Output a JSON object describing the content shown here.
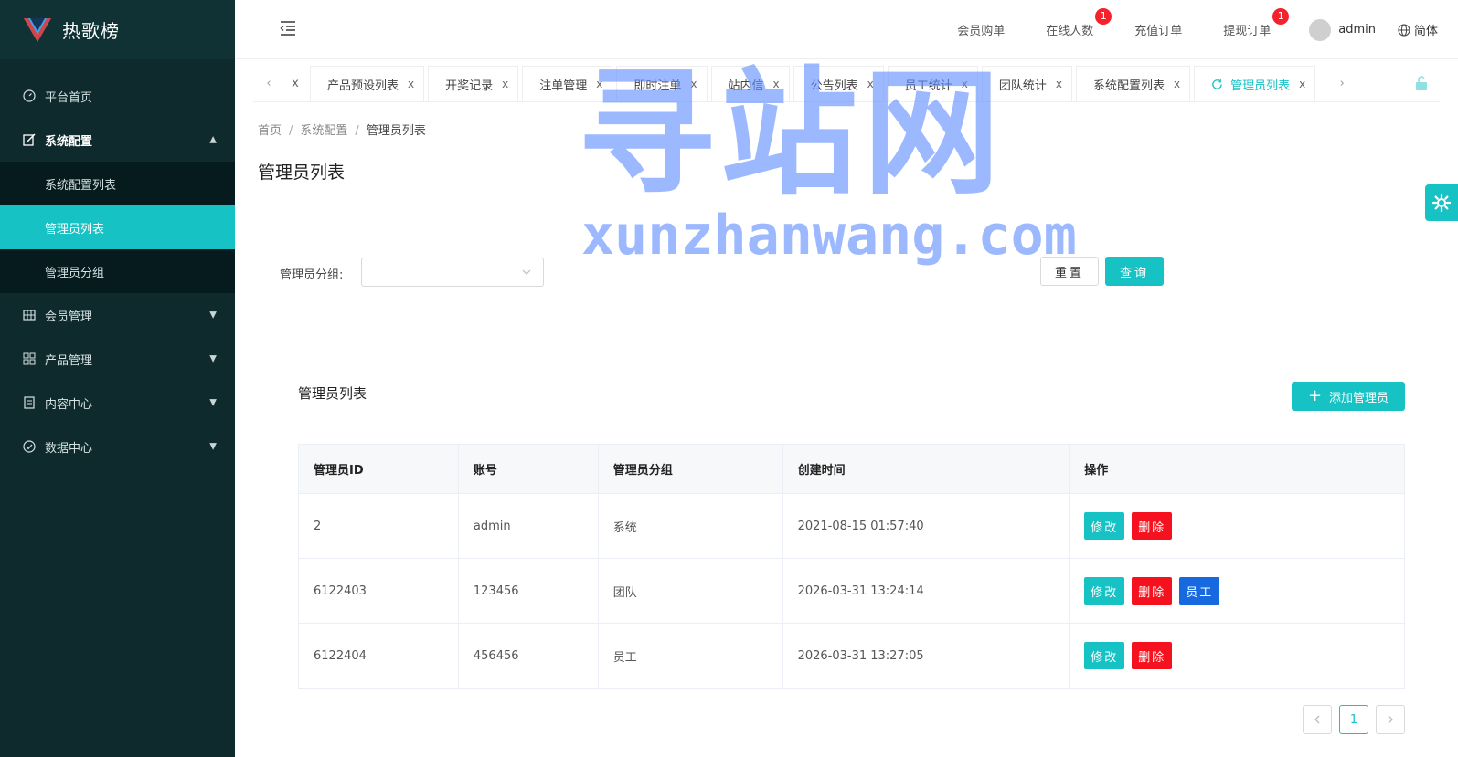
{
  "app": {
    "title": "热歌榜"
  },
  "sidebar": {
    "items": [
      {
        "label": "平台首页",
        "icon": "dashboard-icon"
      },
      {
        "label": "系统配置",
        "icon": "edit-icon",
        "open": true,
        "children": [
          {
            "label": "系统配置列表"
          },
          {
            "label": "管理员列表",
            "active": true
          },
          {
            "label": "管理员分组"
          }
        ]
      },
      {
        "label": "会员管理",
        "icon": "grid-icon"
      },
      {
        "label": "产品管理",
        "icon": "apps-icon"
      },
      {
        "label": "内容中心",
        "icon": "document-icon"
      },
      {
        "label": "数据中心",
        "icon": "check-circle-icon"
      }
    ]
  },
  "header": {
    "links": [
      {
        "label": "会员购单"
      },
      {
        "label": "在线人数",
        "badge": "1"
      },
      {
        "label": "充值订单"
      },
      {
        "label": "提现订单",
        "badge": "1"
      }
    ],
    "user": "admin",
    "lang": "简体"
  },
  "tabs": [
    {
      "label": "产品预设列表"
    },
    {
      "label": "开奖记录"
    },
    {
      "label": "注单管理"
    },
    {
      "label": "即时注单"
    },
    {
      "label": "站内信"
    },
    {
      "label": "公告列表"
    },
    {
      "label": "员工统计"
    },
    {
      "label": "团队统计"
    },
    {
      "label": "系统配置列表"
    },
    {
      "label": "管理员列表",
      "active": true
    }
  ],
  "tab_close": "x",
  "breadcrumb": [
    "首页",
    "系统配置",
    "管理员列表"
  ],
  "breadcrumb_sep": "/",
  "page_title": "管理员列表",
  "filter": {
    "label": "管理员分组:",
    "value": "",
    "reset": "重置",
    "query": "查询"
  },
  "list": {
    "title": "管理员列表",
    "add_button": "添加管理员",
    "columns": [
      "管理员ID",
      "账号",
      "管理员分组",
      "创建时间",
      "操作"
    ],
    "rows": [
      {
        "id": "2",
        "account": "admin",
        "group": "系统",
        "created": "2021-08-15 01:57:40",
        "actions": [
          "修改",
          "删除"
        ]
      },
      {
        "id": "6122403",
        "account": "123456",
        "group": "团队",
        "created": "2026-03-31 13:24:14",
        "actions": [
          "修改",
          "删除",
          "员工"
        ]
      },
      {
        "id": "6122404",
        "account": "456456",
        "group": "员工",
        "created": "2026-03-31 13:27:05",
        "actions": [
          "修改",
          "删除"
        ]
      }
    ]
  },
  "pagination": {
    "current": "1"
  },
  "watermark": {
    "big": "寻站网",
    "small": "xunzhanwang.com"
  },
  "colors": {
    "accent": "#17c2c4",
    "sidebar": "#0f2a2d",
    "danger": "#f5121e",
    "primary": "#1769e0"
  }
}
